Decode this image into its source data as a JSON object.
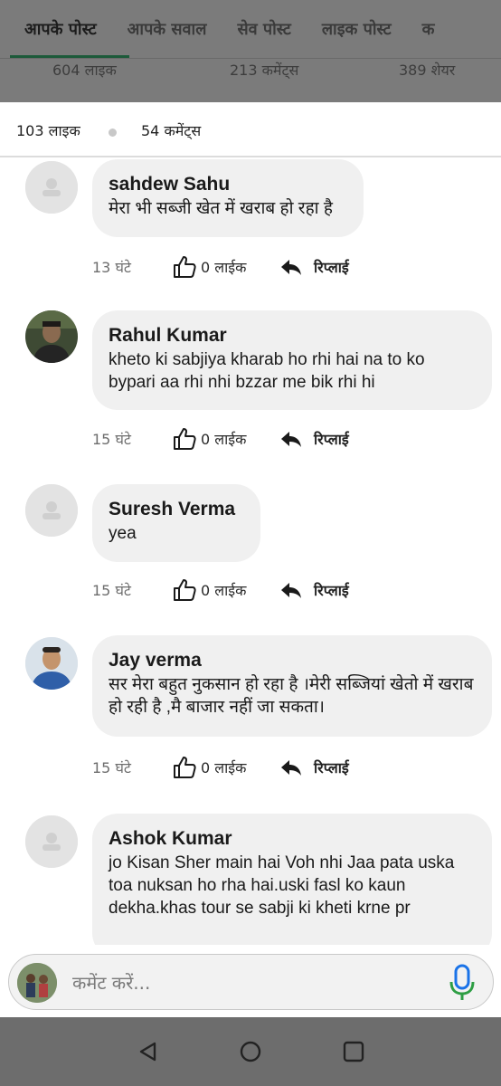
{
  "profile_tabs": [
    "आपके पोस्ट",
    "आपके सवाल",
    "सेव पोस्ट",
    "लाइक पोस्ट",
    "क"
  ],
  "profile_stats": {
    "likes": "604 लाइक",
    "comments": "213 कमेंट्स",
    "shares": "389 शेयर"
  },
  "post_stats": {
    "likes": "103 लाइक",
    "comments": "54 कमेंट्स"
  },
  "comments": [
    {
      "name": "sahdew Sahu",
      "text": "मेरा भी सब्जी खेत में खराब हो रहा है",
      "time": "13 घंटे",
      "likes": "0 लाईक",
      "reply": "रिप्लाई"
    },
    {
      "name": "Rahul Kumar",
      "text": "kheto ki sabjiya kharab ho rhi hai na to ko bypari aa rhi nhi bzzar me bik rhi hi",
      "time": "15 घंटे",
      "likes": "0 लाईक",
      "reply": "रिप्लाई"
    },
    {
      "name": "Suresh Verma",
      "text": "yea",
      "time": "15 घंटे",
      "likes": "0 लाईक",
      "reply": "रिप्लाई"
    },
    {
      "name": "Jay verma",
      "text": "सर मेरा बहुत नुकसान हो रहा है ।मेरी सब्जियां खेतो में खराब हो रही है ,मै बाजार नहीं जा सकता।",
      "time": "15 घंटे",
      "likes": "0 लाईक",
      "reply": "रिप्लाई"
    },
    {
      "name": "Ashok Kumar",
      "text": "jo Kisan Sher main hai Voh nhi Jaa pata uska toa nuksan ho rha hai.uski fasl ko kaun dekha.khas tour se sabji ki kheti krne pr",
      "time": "",
      "likes": "",
      "reply": ""
    }
  ],
  "comment_input": {
    "placeholder": "कमेंट करें..."
  },
  "icons": {
    "like": "thumbs-up-icon",
    "reply": "reply-arrow-icon",
    "mic": "microphone-icon",
    "back": "back-triangle-icon",
    "home": "home-circle-icon",
    "recents": "recents-square-icon"
  },
  "colors": {
    "accent": "#1d5a3a",
    "mic_blue": "#1a73e8",
    "mic_green": "#2e9e44",
    "bubble": "#f0f0f0"
  }
}
